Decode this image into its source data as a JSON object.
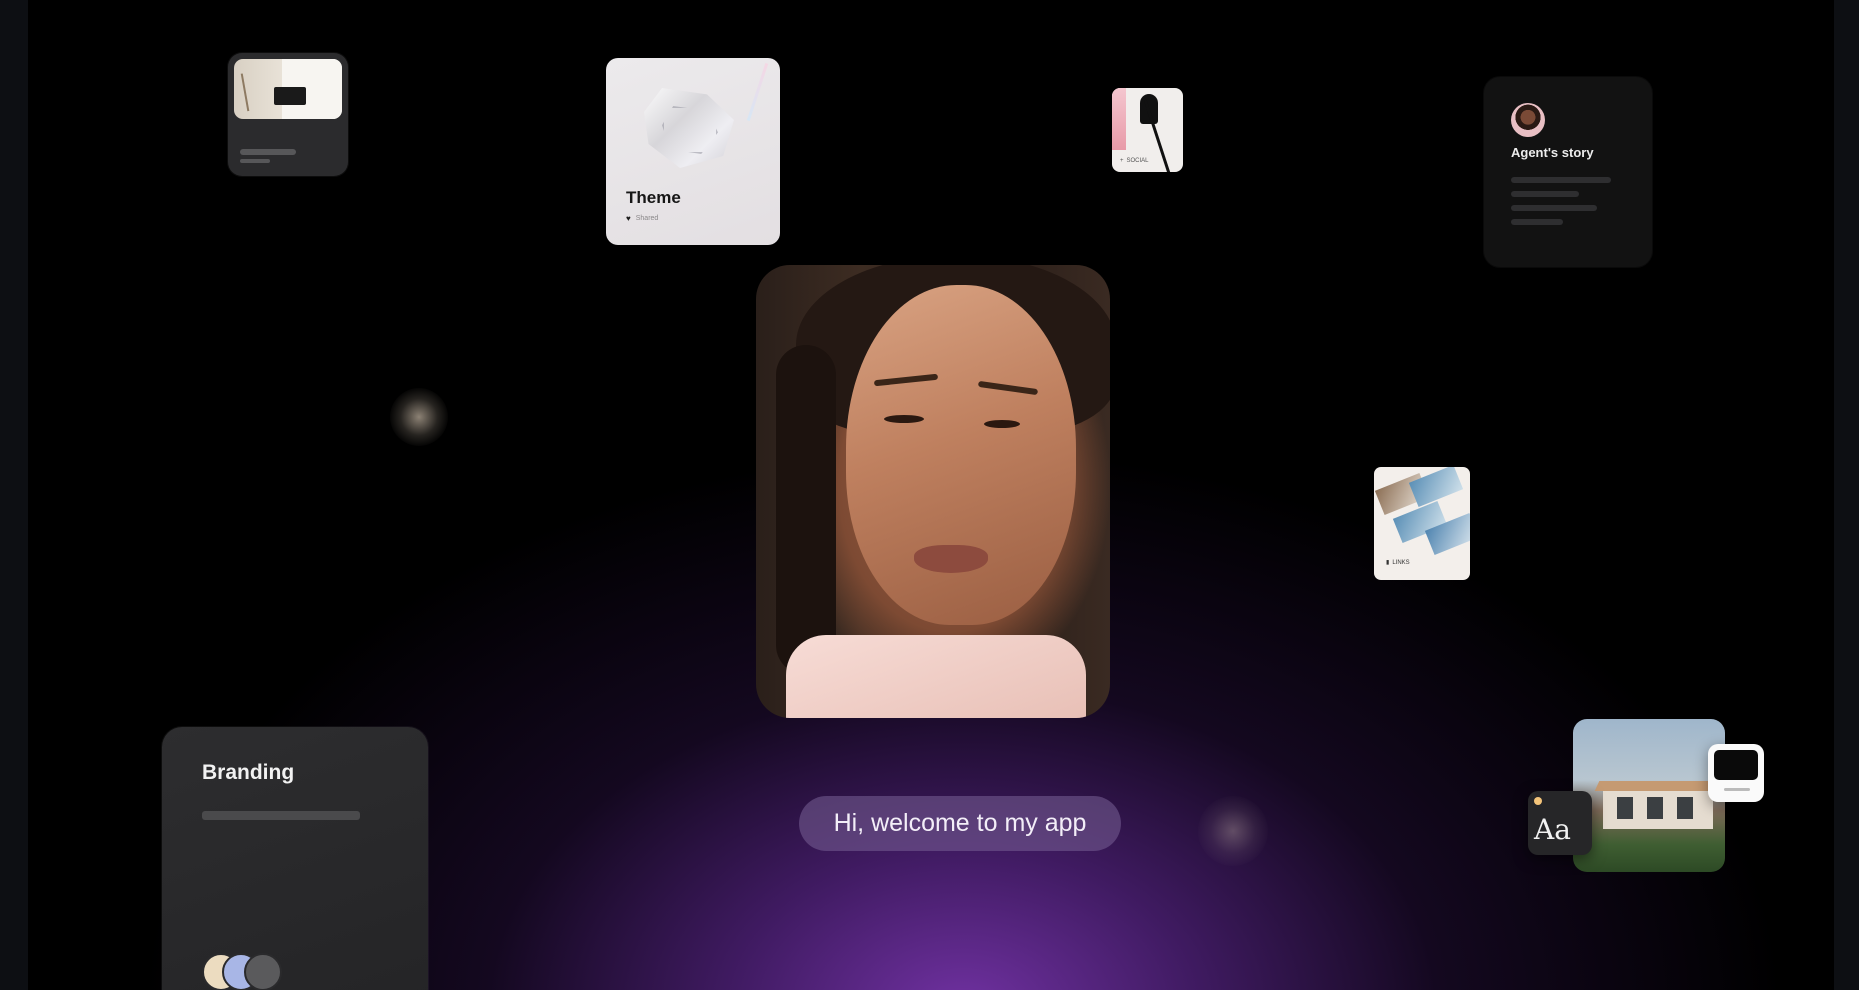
{
  "theme_card": {
    "title": "Theme",
    "subtitle": "Shared",
    "icon": "heart-icon"
  },
  "social_card": {
    "label": "SOCIAL",
    "icon": "plus-icon"
  },
  "agent_card": {
    "title": "Agent's story"
  },
  "links_card": {
    "label": "LINKS",
    "icon": "bookmark-icon"
  },
  "branding_card": {
    "title": "Branding",
    "swatches": [
      "#ecdcc0",
      "#a8b6e6",
      "#5a5a5c"
    ]
  },
  "font_card": {
    "sample": "Aa"
  },
  "welcome": {
    "message": "Hi, welcome to my app"
  },
  "colors": {
    "accent_purple": "#7a34b0",
    "background": "#000000"
  }
}
